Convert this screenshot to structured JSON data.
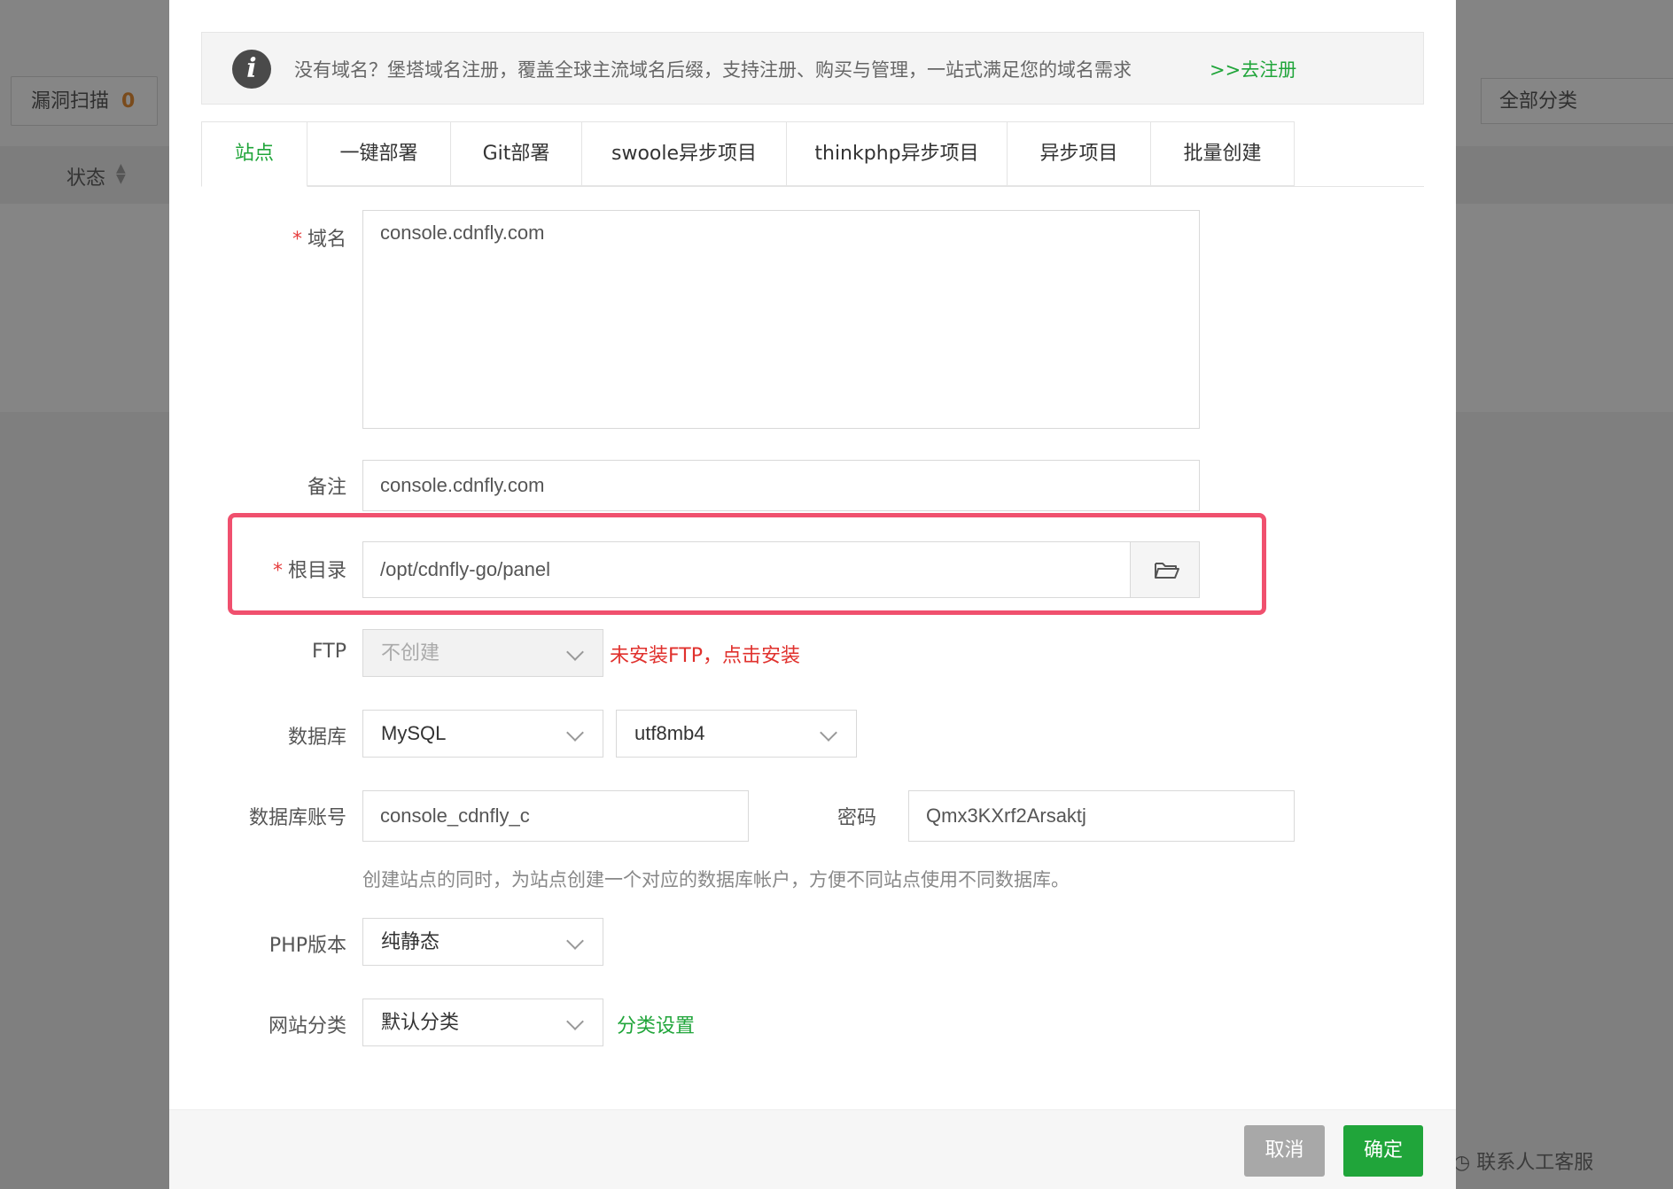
{
  "background": {
    "scan_label": "漏洞扫描",
    "scan_count": "0",
    "status_label": "状态",
    "category_select": "全部分类",
    "support_label": "联系人工客服"
  },
  "notice": {
    "text": "没有域名？堡塔域名注册，覆盖全球主流域名后缀，支持注册、购买与管理，一站式满足您的域名需求",
    "link": ">>去注册"
  },
  "tabs": [
    "站点",
    "一键部署",
    "Git部署",
    "swoole异步项目",
    "thinkphp异步项目",
    "异步项目",
    "批量创建"
  ],
  "form": {
    "domain": {
      "label": "域名",
      "value": "console.cdnfly.com"
    },
    "remark": {
      "label": "备注",
      "value": "console.cdnfly.com"
    },
    "root": {
      "label": "根目录",
      "value": "/opt/cdnfly-go/panel"
    },
    "ftp": {
      "label": "FTP",
      "value": "不创建",
      "warning": "未安装FTP，点击安装"
    },
    "database": {
      "label": "数据库",
      "type": "MySQL",
      "charset": "utf8mb4"
    },
    "db_account": {
      "label": "数据库账号",
      "value": "console_cdnfly_c",
      "password_label": "密码",
      "password": "Qmx3KXrf2Arsaktj"
    },
    "db_hint": "创建站点的同时，为站点创建一个对应的数据库帐户，方便不同站点使用不同数据库。",
    "php": {
      "label": "PHP版本",
      "value": "纯静态"
    },
    "category": {
      "label": "网站分类",
      "value": "默认分类",
      "link": "分类设置"
    }
  },
  "footer": {
    "cancel": "取消",
    "confirm": "确定"
  },
  "colors": {
    "accent": "#20a53a",
    "danger": "#e0312d",
    "highlight": "#f0506e"
  }
}
